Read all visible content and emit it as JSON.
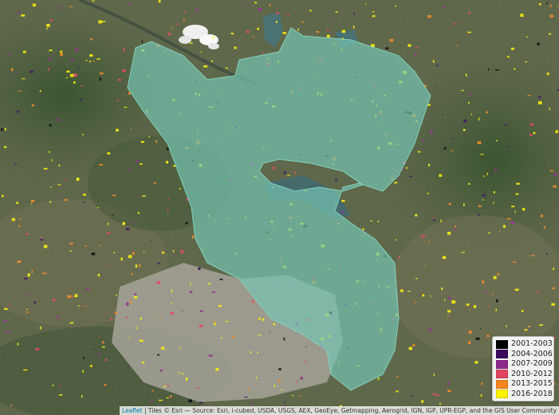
{
  "legend": {
    "items": [
      {
        "label": "2001-2003",
        "color": "#000000"
      },
      {
        "label": "2004-2006",
        "color": "#3b0a5e"
      },
      {
        "label": "2007-2009",
        "color": "#8c2a8a"
      },
      {
        "label": "2010-2012",
        "color": "#e0445e"
      },
      {
        "label": "2013-2015",
        "color": "#f7851e"
      },
      {
        "label": "2016-2018",
        "color": "#fff200"
      }
    ]
  },
  "attribution": {
    "link_text": "Leaflet",
    "text": " | Tiles © Esri — Source: Esri, i-cubed, USDA, USGS, AEX, GeoEye, Getmapping, Aerogrid, IGN, IGP, UPR-EGP, and the GIS User Community"
  },
  "colors": {
    "protected_area_fill": "#6ec7b4",
    "reservoir": "#3f6b6c",
    "urban": "#a3a197"
  }
}
